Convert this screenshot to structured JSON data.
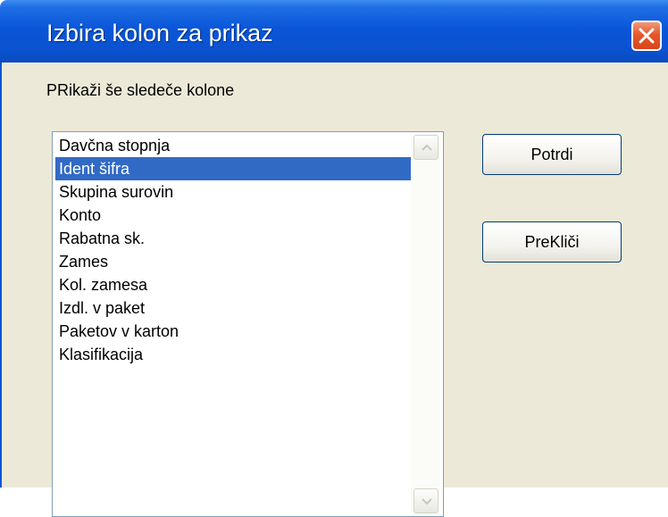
{
  "window": {
    "title": "Izbira kolon za prikaz"
  },
  "prompt": {
    "label": "PRikaži še sledeče kolone"
  },
  "columns_list": {
    "items": [
      {
        "label": "Davčna stopnja",
        "selected": false
      },
      {
        "label": "Ident šifra",
        "selected": true
      },
      {
        "label": "Skupina surovin",
        "selected": false
      },
      {
        "label": "Konto",
        "selected": false
      },
      {
        "label": "Rabatna sk.",
        "selected": false
      },
      {
        "label": "Zames",
        "selected": false
      },
      {
        "label": "Kol. zamesa",
        "selected": false
      },
      {
        "label": "Izdl. v paket",
        "selected": false
      },
      {
        "label": "Paketov v karton",
        "selected": false
      },
      {
        "label": "Klasifikacija",
        "selected": false
      }
    ]
  },
  "buttons": {
    "confirm_label": "Potrdi",
    "cancel_label": "PreKliči"
  },
  "colors": {
    "titlebar": "#0a56d8",
    "selection": "#316ac5",
    "dialog_face": "#ece9d8",
    "close_button": "#e6572c"
  },
  "icons": {
    "close": "close-icon",
    "scroll_up": "chevron-up-icon",
    "scroll_down": "chevron-down-icon"
  }
}
